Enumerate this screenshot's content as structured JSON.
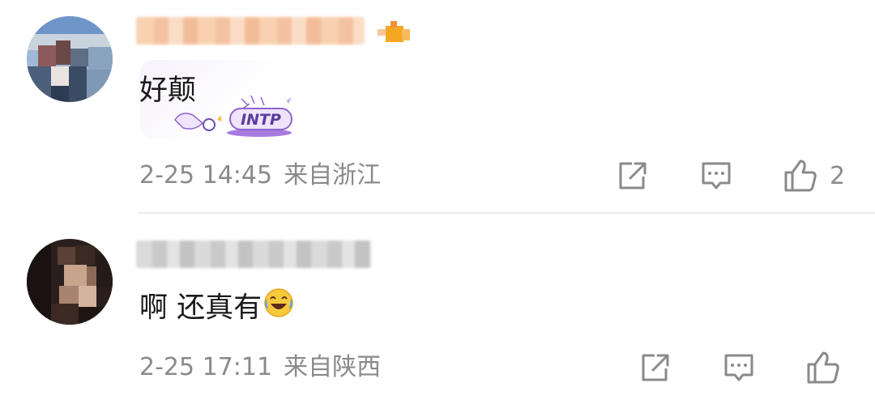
{
  "comments": [
    {
      "text": "好颠",
      "sticker_text": "INTP",
      "timestamp": "2-25 14:45",
      "location": "来自浙江",
      "like_count": "2",
      "icons": {
        "share": "share-icon",
        "reply": "comment-icon",
        "like": "thumbs-up-icon"
      }
    },
    {
      "text": "啊 还真有",
      "emoji": "laughing-crying-emoji",
      "timestamp": "2-25 17:11",
      "location": "来自陕西",
      "icons": {
        "share": "share-icon",
        "reply": "comment-icon",
        "like": "thumbs-up-icon"
      }
    }
  ],
  "colors": {
    "text": "#1a1a1a",
    "meta": "#8a8a8a",
    "divider": "#ececec",
    "sticker_purple": "#a87be0"
  }
}
